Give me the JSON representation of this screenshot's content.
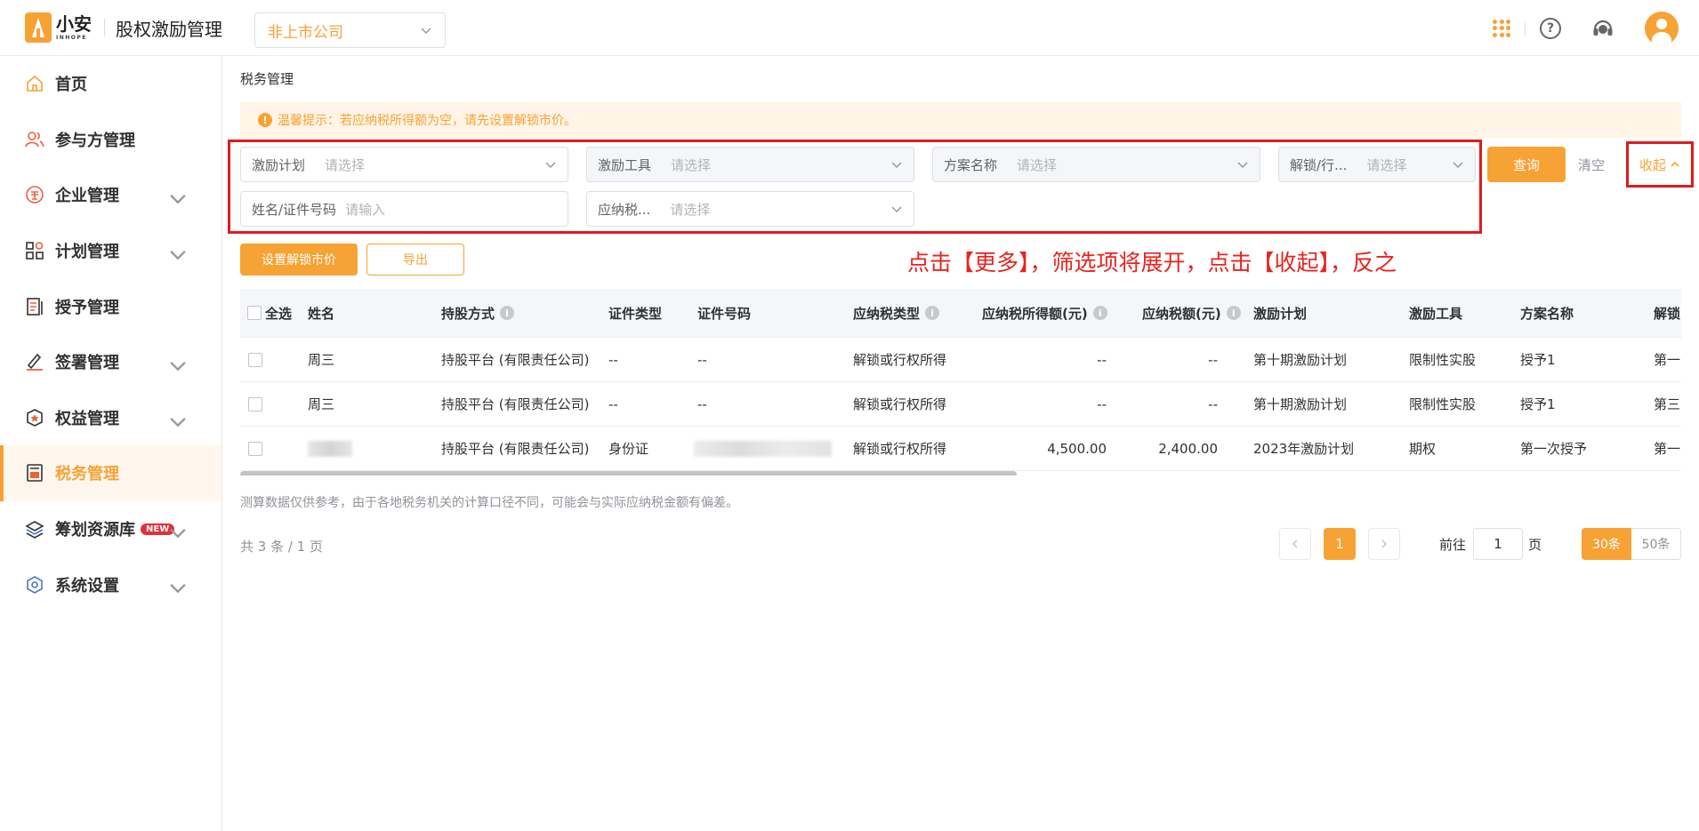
{
  "header": {
    "logo_text": "小安",
    "logo_sub": "INHOPE",
    "app_title": "股权激励管理",
    "company_select": "非上市公司"
  },
  "sidebar": {
    "items": [
      {
        "label": "首页"
      },
      {
        "label": "参与方管理"
      },
      {
        "label": "企业管理"
      },
      {
        "label": "计划管理"
      },
      {
        "label": "授予管理"
      },
      {
        "label": "签署管理"
      },
      {
        "label": "权益管理"
      },
      {
        "label": "税务管理"
      },
      {
        "label": "筹划资源库",
        "badge": "NEW"
      },
      {
        "label": "系统设置"
      }
    ],
    "active_index": 7
  },
  "main": {
    "breadcrumb": "税务管理",
    "tip": "温馨提示：若应纳税所得额为空，请先设置解锁市价。",
    "filters": {
      "plan": {
        "label": "激励计划",
        "placeholder": "请选择"
      },
      "tool": {
        "label": "激励工具",
        "placeholder": "请选择"
      },
      "scheme": {
        "label": "方案名称",
        "placeholder": "请选择"
      },
      "unlock": {
        "label": "解锁/行...",
        "placeholder": "请选择"
      },
      "name": {
        "label": "姓名/证件号码",
        "placeholder": "请输入"
      },
      "taxtype": {
        "label": "应纳税...",
        "placeholder": "请选择"
      }
    },
    "query_label": "查询",
    "clear_label": "清空",
    "collapse_label": "收起",
    "set_price_label": "设置解锁市价",
    "export_label": "导出",
    "annotation": "点击【更多】，筛选项将展开，点击【收起】，反之",
    "table": {
      "select_all": "全选",
      "headers": [
        "姓名",
        "持股方式",
        "证件类型",
        "证件号码",
        "应纳税类型",
        "应纳税所得额(元)",
        "应纳税额(元)",
        "激励计划",
        "激励工具",
        "方案名称",
        "解锁"
      ],
      "rows": [
        [
          "周三",
          "持股平台 (有限责任公司)",
          "--",
          "--",
          "解锁或行权所得",
          "--",
          "--",
          "第十期激励计划",
          "限制性实股",
          "授予1",
          "第一"
        ],
        [
          "周三",
          "持股平台 (有限责任公司)",
          "--",
          "--",
          "解锁或行权所得",
          "--",
          "--",
          "第十期激励计划",
          "限制性实股",
          "授予1",
          "第三"
        ],
        [
          "",
          "持股平台 (有限责任公司)",
          "身份证",
          "",
          "解锁或行权所得",
          "4,500.00",
          "2,400.00",
          "2023年激励计划",
          "期权",
          "第一次授予",
          "第一"
        ]
      ]
    },
    "disclaimer": "测算数据仅供参考，由于各地税务机关的计算口径不同，可能会与实际应纳税金额有偏差。",
    "pagination": {
      "total": "共 3 条 / 1 页",
      "current_page": "1",
      "goto_prefix": "前往",
      "goto_value": "1",
      "goto_suffix": "页",
      "size_30": "30条",
      "size_50": "50条"
    }
  },
  "colors": {
    "accent": "#f7a234",
    "highlight_box": "#e01b1b",
    "annotation": "#e8231e"
  }
}
